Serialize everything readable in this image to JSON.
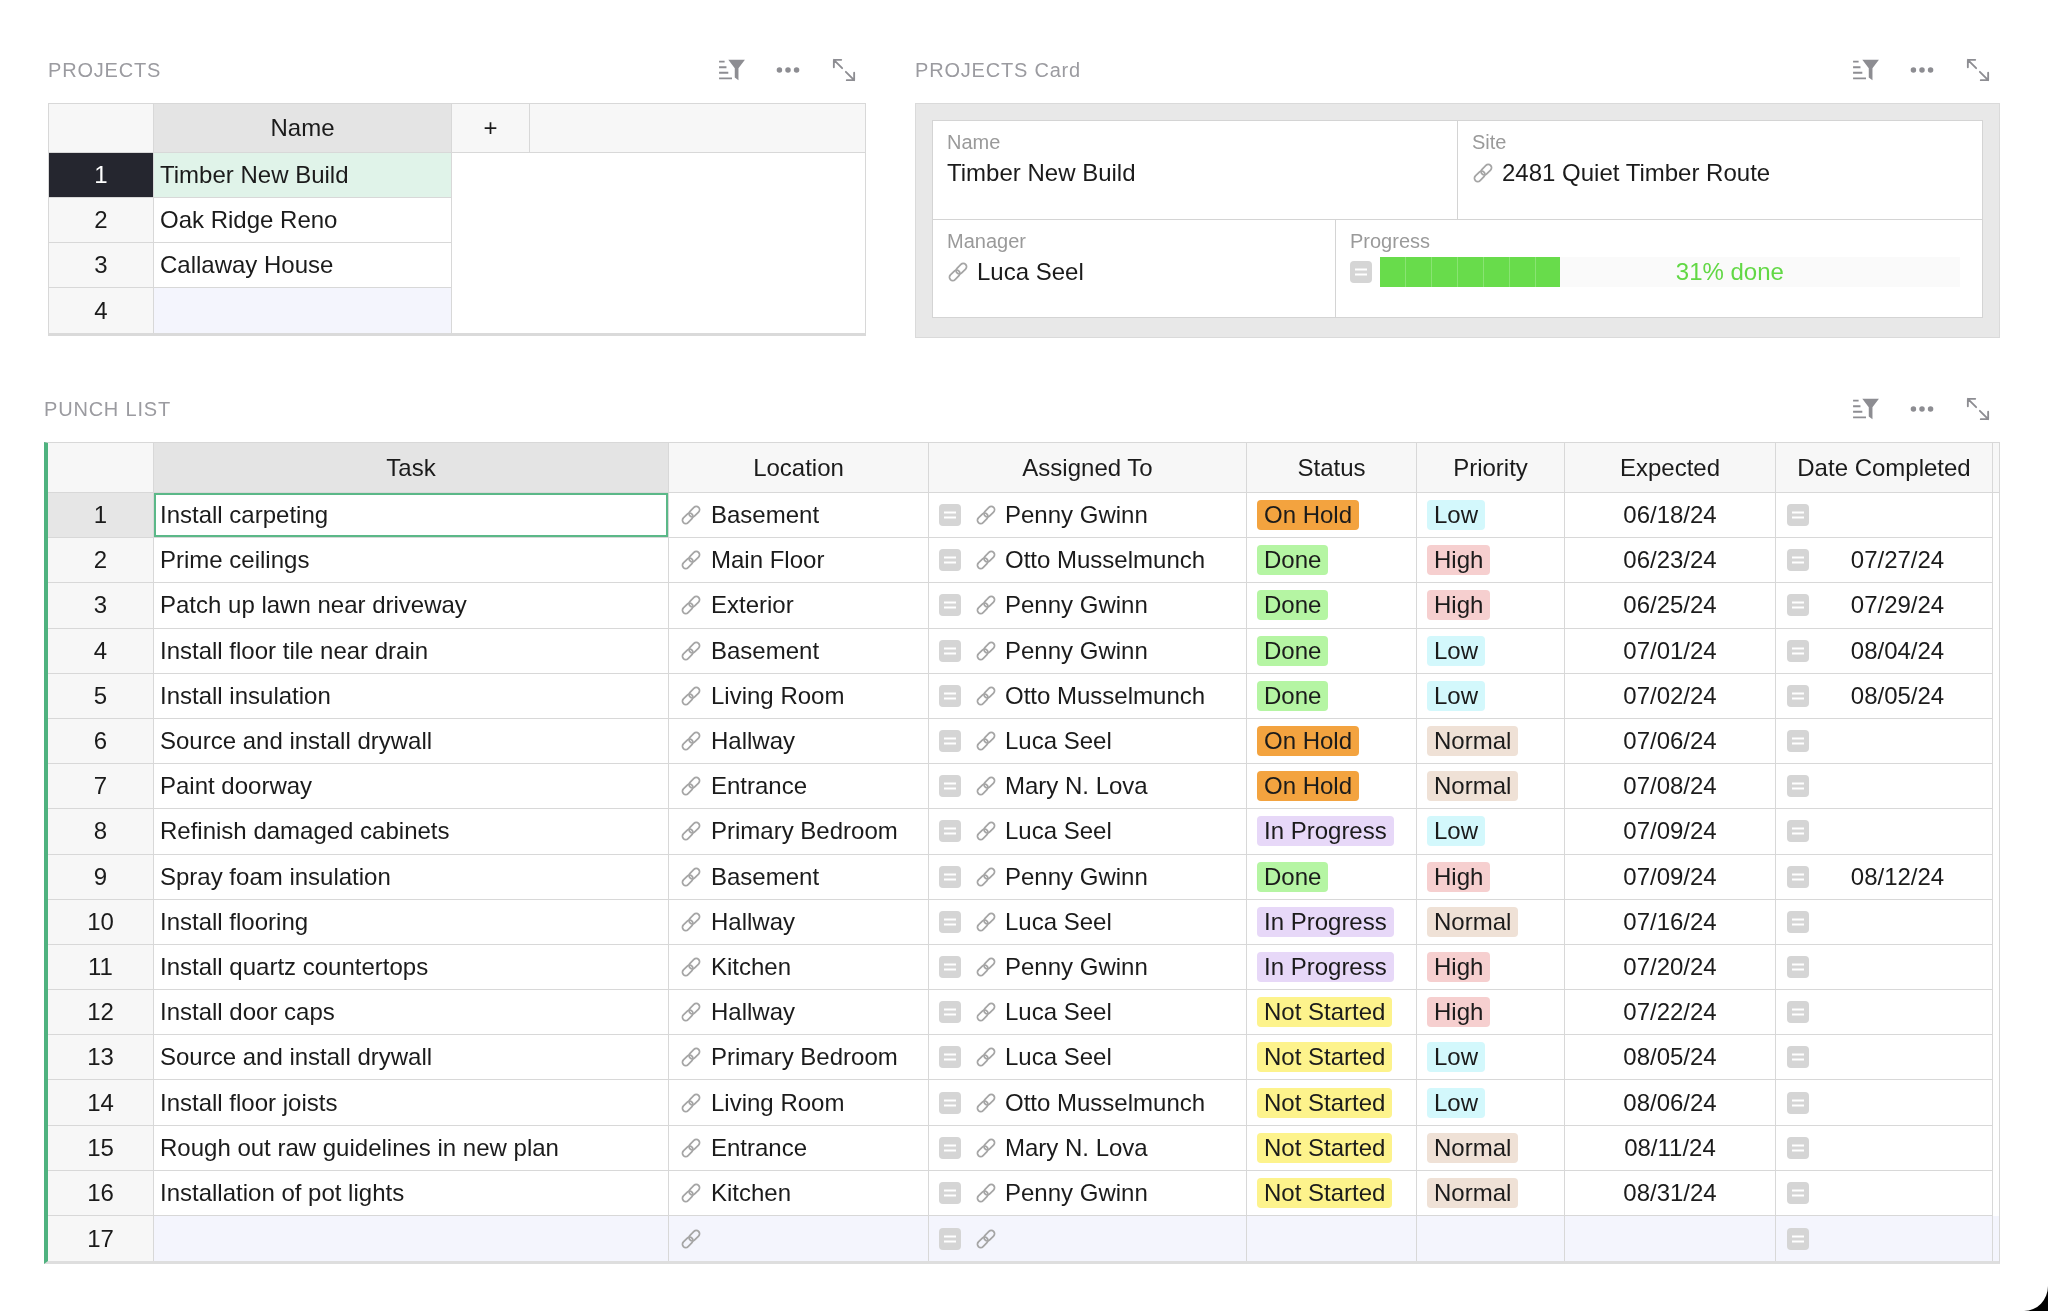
{
  "projects": {
    "title": "PROJECTS",
    "columns": [
      {
        "label": "Name",
        "selected": true
      }
    ],
    "add_column": "+",
    "rows": [
      {
        "number": "1",
        "name": "Timber New Build",
        "selected": true
      },
      {
        "number": "2",
        "name": "Oak Ridge Reno",
        "selected": false
      },
      {
        "number": "3",
        "name": "Callaway House",
        "selected": false
      }
    ],
    "new_row": {
      "number": "4"
    }
  },
  "projects_card": {
    "title": "PROJECTS Card",
    "rows": [
      {
        "fields": [
          {
            "kind": "text",
            "label": "Name",
            "value": "Timber New Build"
          },
          {
            "kind": "link",
            "label": "Site",
            "value": "2481 Quiet Timber Route"
          }
        ]
      },
      {
        "fields": [
          {
            "kind": "link",
            "label": "Manager",
            "value": "Luca Seel"
          },
          {
            "kind": "progress",
            "label": "Progress",
            "level": 0.31,
            "reading": "31% done"
          }
        ]
      }
    ]
  },
  "punch_list": {
    "title": "PUNCH LIST",
    "columns": [
      {
        "label": "Task",
        "selected": true
      },
      {
        "label": "Location",
        "selected": false
      },
      {
        "label": "Assigned To",
        "selected": false
      },
      {
        "label": "Status",
        "selected": false
      },
      {
        "label": "Priority",
        "selected": false
      },
      {
        "label": "Expected",
        "selected": false
      },
      {
        "label": "Date Completed",
        "selected": false
      }
    ],
    "rows": [
      {
        "number": "1",
        "selected": true,
        "task": "Install carpeting",
        "location": "Basement",
        "assigned_to": "Penny Gwinn",
        "status": {
          "label": "On Hold",
          "color": "#f3a33f"
        },
        "priority": {
          "label": "Low",
          "color": "#d3f8fc"
        },
        "expected": "06/18/24"
      },
      {
        "number": "2",
        "selected": false,
        "task": "Prime ceilings",
        "location": "Main Floor",
        "assigned_to": "Otto Musselmunch",
        "status": {
          "label": "Done",
          "color": "#b5f5a3"
        },
        "priority": {
          "label": "High",
          "color": "#f6cfcf"
        },
        "expected": "06/23/24",
        "date_completed": "07/27/24"
      },
      {
        "number": "3",
        "selected": false,
        "task": "Patch up lawn near driveway",
        "location": "Exterior",
        "assigned_to": "Penny Gwinn",
        "status": {
          "label": "Done",
          "color": "#b5f5a3"
        },
        "priority": {
          "label": "High",
          "color": "#f6cfcf"
        },
        "expected": "06/25/24",
        "date_completed": "07/29/24"
      },
      {
        "number": "4",
        "selected": false,
        "task": "Install floor tile near drain",
        "location": "Basement",
        "assigned_to": "Penny Gwinn",
        "status": {
          "label": "Done",
          "color": "#b5f5a3"
        },
        "priority": {
          "label": "Low",
          "color": "#d3f8fc"
        },
        "expected": "07/01/24",
        "date_completed": "08/04/24"
      },
      {
        "number": "5",
        "selected": false,
        "task": "Install insulation",
        "location": "Living Room",
        "assigned_to": "Otto Musselmunch",
        "status": {
          "label": "Done",
          "color": "#b5f5a3"
        },
        "priority": {
          "label": "Low",
          "color": "#d3f8fc"
        },
        "expected": "07/02/24",
        "date_completed": "08/05/24"
      },
      {
        "number": "6",
        "selected": false,
        "task": "Source and install drywall",
        "location": "Hallway",
        "assigned_to": "Luca Seel",
        "status": {
          "label": "On Hold",
          "color": "#f3a33f"
        },
        "priority": {
          "label": "Normal",
          "color": "#efe1d6"
        },
        "expected": "07/06/24"
      },
      {
        "number": "7",
        "selected": false,
        "task": "Paint doorway",
        "location": "Entrance",
        "assigned_to": "Mary N. Lova",
        "status": {
          "label": "On Hold",
          "color": "#f3a33f"
        },
        "priority": {
          "label": "Normal",
          "color": "#efe1d6"
        },
        "expected": "07/08/24"
      },
      {
        "number": "8",
        "selected": false,
        "task": "Refinish damaged cabinets",
        "location": "Primary Bedroom",
        "assigned_to": "Luca Seel",
        "status": {
          "label": "In Progress",
          "color": "#e7d8f8"
        },
        "priority": {
          "label": "Low",
          "color": "#d3f8fc"
        },
        "expected": "07/09/24"
      },
      {
        "number": "9",
        "selected": false,
        "task": "Spray foam insulation",
        "location": "Basement",
        "assigned_to": "Penny Gwinn",
        "status": {
          "label": "Done",
          "color": "#b5f5a3"
        },
        "priority": {
          "label": "High",
          "color": "#f6cfcf"
        },
        "expected": "07/09/24",
        "date_completed": "08/12/24"
      },
      {
        "number": "10",
        "selected": false,
        "task": "Install flooring",
        "location": "Hallway",
        "assigned_to": "Luca Seel",
        "status": {
          "label": "In Progress",
          "color": "#e7d8f8"
        },
        "priority": {
          "label": "Normal",
          "color": "#efe1d6"
        },
        "expected": "07/16/24"
      },
      {
        "number": "11",
        "selected": false,
        "task": "Install quartz countertops",
        "location": "Kitchen",
        "assigned_to": "Penny Gwinn",
        "status": {
          "label": "In Progress",
          "color": "#e7d8f8"
        },
        "priority": {
          "label": "High",
          "color": "#f6cfcf"
        },
        "expected": "07/20/24"
      },
      {
        "number": "12",
        "selected": false,
        "task": "Install door caps",
        "location": "Hallway",
        "assigned_to": "Luca Seel",
        "status": {
          "label": "Not Started",
          "color": "#fdf38c"
        },
        "priority": {
          "label": "High",
          "color": "#f6cfcf"
        },
        "expected": "07/22/24"
      },
      {
        "number": "13",
        "selected": false,
        "task": "Source and install drywall",
        "location": "Primary Bedroom",
        "assigned_to": "Luca Seel",
        "status": {
          "label": "Not Started",
          "color": "#fdf38c"
        },
        "priority": {
          "label": "Low",
          "color": "#d3f8fc"
        },
        "expected": "08/05/24"
      },
      {
        "number": "14",
        "selected": false,
        "task": "Install floor joists",
        "location": "Living Room",
        "assigned_to": "Otto Musselmunch",
        "status": {
          "label": "Not Started",
          "color": "#fdf38c"
        },
        "priority": {
          "label": "Low",
          "color": "#d3f8fc"
        },
        "expected": "08/06/24"
      },
      {
        "number": "15",
        "selected": false,
        "task": "Rough out raw guidelines in new plan",
        "location": "Entrance",
        "assigned_to": "Mary N. Lova",
        "status": {
          "label": "Not Started",
          "color": "#fdf38c"
        },
        "priority": {
          "label": "Normal",
          "color": "#efe1d6"
        },
        "expected": "08/11/24"
      },
      {
        "number": "16",
        "selected": false,
        "task": "Installation of pot lights",
        "location": "Kitchen",
        "assigned_to": "Penny Gwinn",
        "status": {
          "label": "Not Started",
          "color": "#fdf38c"
        },
        "priority": {
          "label": "Normal",
          "color": "#efe1d6"
        },
        "expected": "08/31/24"
      }
    ],
    "new_row": {
      "number": "17"
    }
  }
}
